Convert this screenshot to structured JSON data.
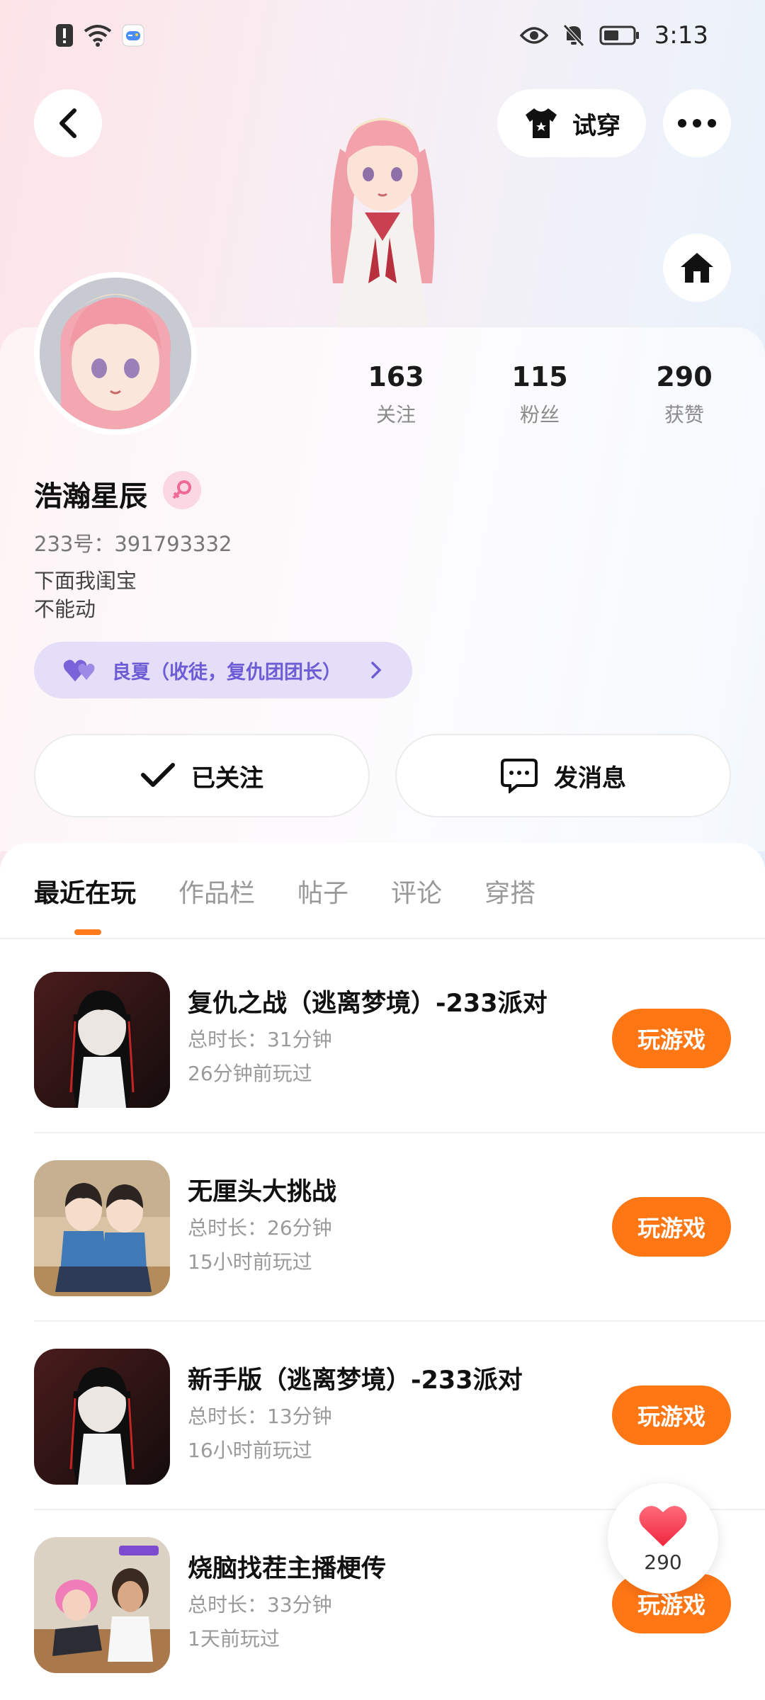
{
  "status_bar": {
    "time": "3:13"
  },
  "header": {
    "try_on_label": "试穿"
  },
  "profile": {
    "stats": [
      {
        "num": "163",
        "label": "关注"
      },
      {
        "num": "115",
        "label": "粉丝"
      },
      {
        "num": "290",
        "label": "获赞"
      }
    ],
    "name": "浩瀚星辰",
    "uid": "233号：391793332",
    "bio_line1": "下面我闺宝",
    "bio_line2": "不能动",
    "badge": "良夏（收徒，复仇团团长）"
  },
  "actions": {
    "follow_label": "已关注",
    "message_label": "发消息"
  },
  "tabs": [
    "最近在玩",
    "作品栏",
    "帖子",
    "评论",
    "穿搭"
  ],
  "games": [
    {
      "title": "复仇之战（逃离梦境）-233派对",
      "duration": "总时长：31分钟",
      "last_played": "26分钟前玩过",
      "button": "玩游戏"
    },
    {
      "title": "无厘头大挑战",
      "duration": "总时长：26分钟",
      "last_played": "15小时前玩过",
      "button": "玩游戏"
    },
    {
      "title": "新手版（逃离梦境）-233派对",
      "duration": "总时长：13分钟",
      "last_played": "16小时前玩过",
      "button": "玩游戏"
    },
    {
      "title": "烧脑找茬主播梗传",
      "duration": "总时长：33分钟",
      "last_played": "1天前玩过",
      "button": "玩游戏"
    }
  ],
  "like_bubble": {
    "count": "290"
  },
  "colors": {
    "accent": "#ff7614",
    "badge_text": "#6c5cd6",
    "badge_bg": "#e4def8",
    "gender_bg": "#fbd6e3"
  }
}
